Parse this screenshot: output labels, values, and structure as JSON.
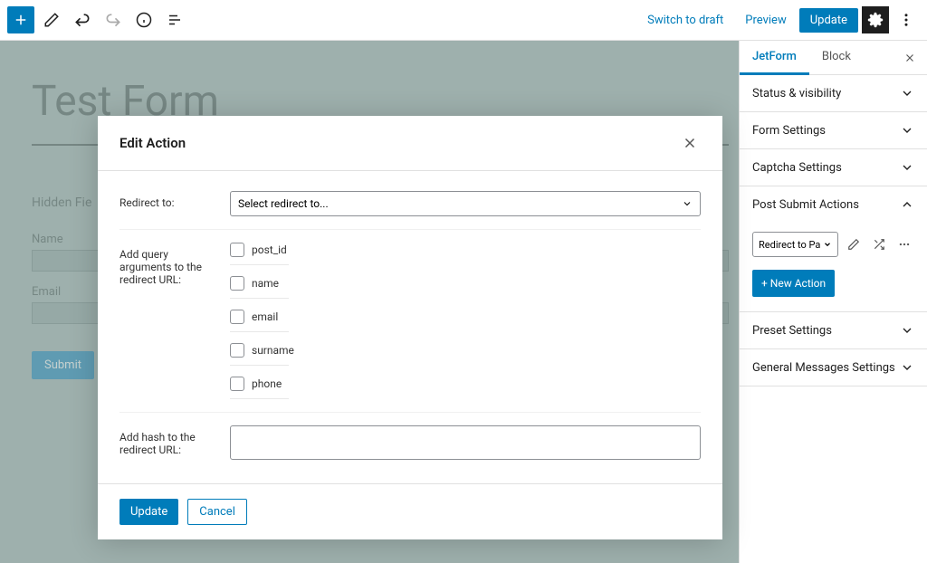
{
  "toolbar": {
    "switch_draft": "Switch to draft",
    "preview": "Preview",
    "update": "Update"
  },
  "editor": {
    "title": "Test Form",
    "hidden_field_label": "Hidden Fie",
    "name_label": "Name",
    "email_label": "Email",
    "submit_label": "Submit"
  },
  "sidebar": {
    "tabs": {
      "jetform": "JetForm",
      "block": "Block"
    },
    "panels": {
      "status": "Status & visibility",
      "form_settings": "Form Settings",
      "captcha": "Captcha Settings",
      "post_submit": "Post Submit Actions",
      "preset": "Preset Settings",
      "messages": "General Messages Settings"
    },
    "action_value": "Redirect to Pa",
    "new_action": "+ New Action"
  },
  "modal": {
    "title": "Edit Action",
    "redirect_label": "Redirect to:",
    "redirect_placeholder": "Select redirect to...",
    "query_label": "Add query arguments to the redirect URL:",
    "checks": [
      "post_id",
      "name",
      "email",
      "surname",
      "phone"
    ],
    "hash_label": "Add hash to the redirect URL:",
    "update": "Update",
    "cancel": "Cancel"
  }
}
